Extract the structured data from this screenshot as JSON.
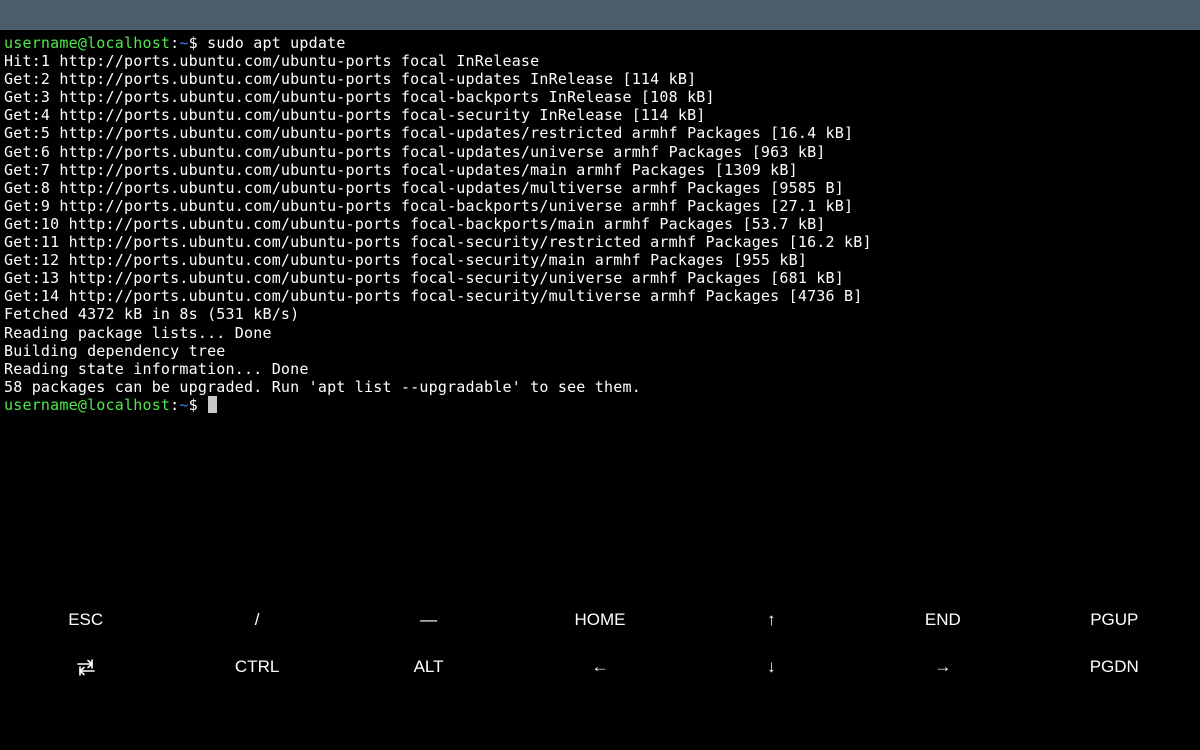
{
  "terminal": {
    "prompt": {
      "user_host": "username@localhost",
      "separator": ":",
      "path": "~",
      "symbol": "$ "
    },
    "command": "sudo apt update",
    "output": [
      "Hit:1 http://ports.ubuntu.com/ubuntu-ports focal InRelease",
      "Get:2 http://ports.ubuntu.com/ubuntu-ports focal-updates InRelease [114 kB]",
      "Get:3 http://ports.ubuntu.com/ubuntu-ports focal-backports InRelease [108 kB]",
      "Get:4 http://ports.ubuntu.com/ubuntu-ports focal-security InRelease [114 kB]",
      "Get:5 http://ports.ubuntu.com/ubuntu-ports focal-updates/restricted armhf Packages [16.4 kB]",
      "Get:6 http://ports.ubuntu.com/ubuntu-ports focal-updates/universe armhf Packages [963 kB]",
      "Get:7 http://ports.ubuntu.com/ubuntu-ports focal-updates/main armhf Packages [1309 kB]",
      "Get:8 http://ports.ubuntu.com/ubuntu-ports focal-updates/multiverse armhf Packages [9585 B]",
      "Get:9 http://ports.ubuntu.com/ubuntu-ports focal-backports/universe armhf Packages [27.1 kB]",
      "Get:10 http://ports.ubuntu.com/ubuntu-ports focal-backports/main armhf Packages [53.7 kB]",
      "Get:11 http://ports.ubuntu.com/ubuntu-ports focal-security/restricted armhf Packages [16.2 kB]",
      "Get:12 http://ports.ubuntu.com/ubuntu-ports focal-security/main armhf Packages [955 kB]",
      "Get:13 http://ports.ubuntu.com/ubuntu-ports focal-security/universe armhf Packages [681 kB]",
      "Get:14 http://ports.ubuntu.com/ubuntu-ports focal-security/multiverse armhf Packages [4736 B]",
      "Fetched 4372 kB in 8s (531 kB/s)",
      "Reading package lists... Done",
      "Building dependency tree",
      "Reading state information... Done",
      "58 packages can be upgraded. Run 'apt list --upgradable' to see them."
    ]
  },
  "extra_keys": {
    "row1": [
      {
        "label": "ESC",
        "name": "esc-key"
      },
      {
        "label": "/",
        "name": "slash-key"
      },
      {
        "label": "―",
        "name": "dash-key"
      },
      {
        "label": "HOME",
        "name": "home-key"
      },
      {
        "label": "↑",
        "name": "up-arrow-key"
      },
      {
        "label": "END",
        "name": "end-key"
      },
      {
        "label": "PGUP",
        "name": "pgup-key"
      }
    ],
    "row2": [
      {
        "icon": "tab-arrows-icon",
        "name": "tab-key"
      },
      {
        "label": "CTRL",
        "name": "ctrl-key"
      },
      {
        "label": "ALT",
        "name": "alt-key"
      },
      {
        "label": "←",
        "name": "left-arrow-key"
      },
      {
        "label": "↓",
        "name": "down-arrow-key"
      },
      {
        "label": "→",
        "name": "right-arrow-key"
      },
      {
        "label": "PGDN",
        "name": "pgdn-key"
      }
    ]
  },
  "colors": {
    "background": "#000000",
    "status_bar": "#4b5d68",
    "prompt_user": "#50e84c",
    "prompt_path": "#3b82f6",
    "text": "#ffffff",
    "cursor": "#c8c8c8"
  }
}
